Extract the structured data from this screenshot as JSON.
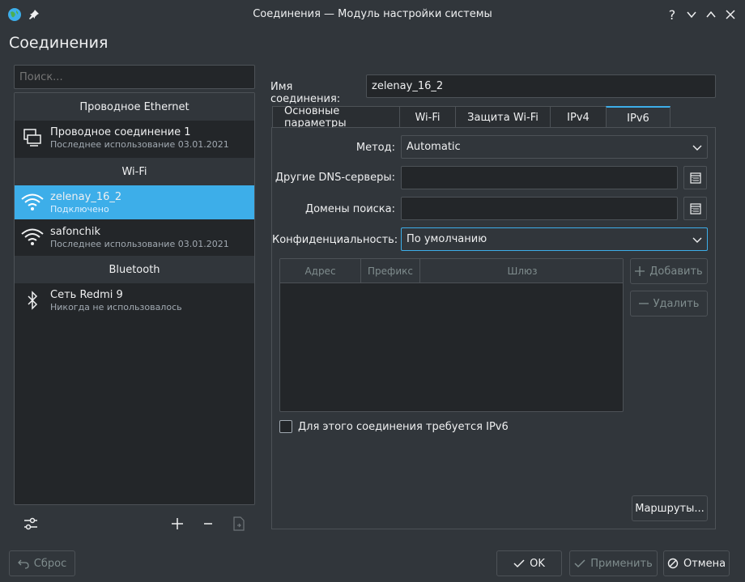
{
  "window": {
    "title": "Соединения — Модуль настройки системы",
    "help": "?",
    "page_title": "Соединения"
  },
  "search": {
    "placeholder": "Поиск..."
  },
  "groups": {
    "ethernet": "Проводное Ethernet",
    "wifi": "Wi-Fi",
    "bluetooth": "Bluetooth"
  },
  "connections": [
    {
      "name": "Проводное соединение 1",
      "sub": "Последнее использование 03.01.2021",
      "icon": "computer-icon"
    },
    {
      "name": "zelenay_16_2",
      "sub": "Подключено",
      "icon": "wifi-icon",
      "selected": true
    },
    {
      "name": "safonchik",
      "sub": "Последнее использование 03.01.2021",
      "icon": "wifi-icon"
    },
    {
      "name": "Сеть Redmi 9",
      "sub": "Никогда не использовалось",
      "icon": "bluetooth-icon"
    }
  ],
  "connection_name": {
    "label": "Имя соединения:",
    "value": "zelenay_16_2"
  },
  "tabs": [
    "Основные параметры",
    "Wi-Fi",
    "Защита Wi-Fi",
    "IPv4",
    "IPv6"
  ],
  "active_tab": "IPv6",
  "form": {
    "method_label": "Метод:",
    "method_value": "Automatic",
    "dns_label": "Другие DNS-серверы:",
    "dns_value": "",
    "search_domains_label": "Домены поиска:",
    "search_domains_value": "",
    "privacy_label": "Конфиденциальность:",
    "privacy_value": "По умолчанию"
  },
  "table": {
    "columns": [
      "Адрес",
      "Префикс",
      "Шлюз"
    ],
    "rows": []
  },
  "buttons": {
    "add": "Добавить",
    "remove": "Удалить",
    "routes": "Маршруты...",
    "reset": "Сброс",
    "ok": "OK",
    "apply": "Применить",
    "cancel": "Отмена"
  },
  "require_ipv6": {
    "label": "Для этого соединения требуется IPv6",
    "checked": false
  },
  "colors": {
    "accent": "#3daee9",
    "background": "#31363b",
    "field": "#232629",
    "border": "#4d5257"
  }
}
